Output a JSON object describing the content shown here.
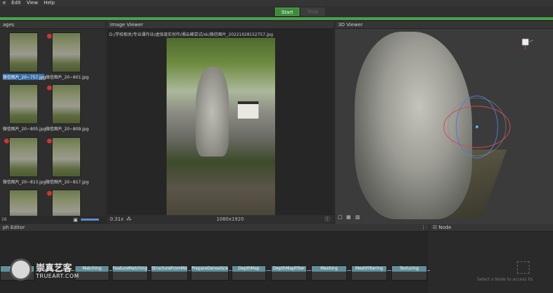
{
  "menu": {
    "items": [
      "e",
      "Edit",
      "View",
      "Help"
    ]
  },
  "toolbar": {
    "start_label": "Start",
    "stop_label": "Stop",
    "progress": 1.0
  },
  "images_panel": {
    "title": "ages",
    "count": "16",
    "thumbnails": [
      {
        "caption": "微信图片_20~757.jpg",
        "selected": true,
        "error": false
      },
      {
        "caption": "微信图片_20~801.jpg",
        "selected": false,
        "error": true
      },
      {
        "caption": "微信图片_20~805.jpg",
        "selected": false,
        "error": false
      },
      {
        "caption": "微信图片_20~809.jpg",
        "selected": false,
        "error": true
      },
      {
        "caption": "微信图片_20~813.jpg",
        "selected": false,
        "error": true
      },
      {
        "caption": "微信图片_20~817.jpg",
        "selected": false,
        "error": true
      },
      {
        "caption": "",
        "selected": false,
        "error": false
      },
      {
        "caption": "",
        "selected": false,
        "error": true
      }
    ]
  },
  "image_viewer": {
    "title": "Image Viewer",
    "path": "D:/学校相关/专业课作业/虚拟现实创作/湘云峰尝试/sk/微信图片_20221028152757.jpg",
    "zoom": "0.31x",
    "resolution": "1080x1920"
  },
  "viewer3d": {
    "title": "3D Viewer"
  },
  "graph_editor": {
    "title": "ph Editor",
    "nodes": [
      "Camera",
      "Matching",
      "FeatureMatching",
      "StructureFromMotion",
      "PrepareDenseScene",
      "DepthMap",
      "DepthMapFilter",
      "Meshing",
      "MeshFiltering",
      "Texturing"
    ]
  },
  "node_panel": {
    "title": "Node",
    "hint": "Select a Node to access its"
  },
  "watermark": {
    "cn": "崇真艺客",
    "en": "TRUEART.COM"
  }
}
